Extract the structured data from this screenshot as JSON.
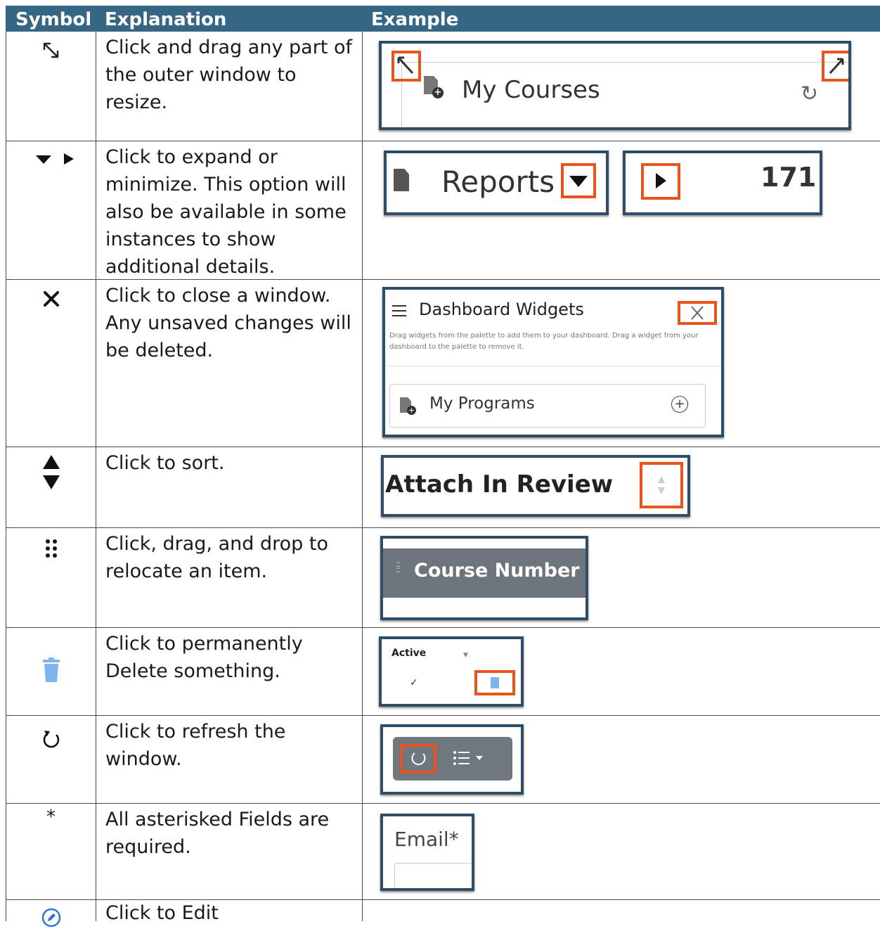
{
  "headers": {
    "symbol": "Symbol",
    "explanation": "Explanation",
    "example": "Example"
  },
  "rows": [
    {
      "explanation": "Click and drag any part of the outer window to resize.",
      "example": {
        "title": "My Courses"
      }
    },
    {
      "explanation": "Click to expand or minimize. This option will also be available in some instances to show additional details.",
      "example": {
        "title": "Reports",
        "count": "171"
      }
    },
    {
      "explanation": "Click to close a window. Any unsaved changes will be deleted.",
      "example": {
        "title": "Dashboard Widgets",
        "desc": "Drag widgets from the palette to add them to your dashboard. Drag a widget from your dashboard to the palette to remove it.",
        "item": "My Programs"
      }
    },
    {
      "explanation": "Click to sort.",
      "example": {
        "title": "Attach In Review"
      }
    },
    {
      "explanation": "Click, drag, and drop to relocate an item.",
      "example": {
        "title": "Course Number"
      }
    },
    {
      "explanation": "Click to permanently Delete something.",
      "example": {
        "title": "Active"
      }
    },
    {
      "explanation": "Click to refresh the window.",
      "example": {}
    },
    {
      "symbol": "*",
      "explanation": "All asterisked Fields are required.",
      "example": {
        "title": "Email*"
      }
    },
    {
      "explanation": "Click to Edit",
      "example": {}
    }
  ],
  "colors": {
    "header_bg": "#356784",
    "highlight": "#e8541c",
    "frame": "#2f4d66",
    "trash": "#7fb3ec",
    "edit": "#2b78d6"
  }
}
